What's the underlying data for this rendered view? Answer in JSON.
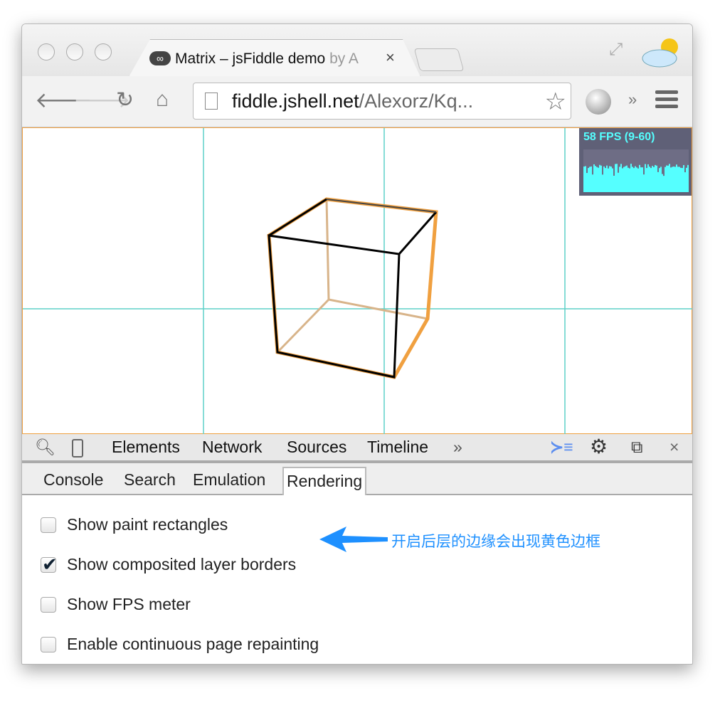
{
  "tab": {
    "title": "Matrix – jsFiddle demo ",
    "title_fade": "by A",
    "close": "×"
  },
  "toolbar": {
    "url_host": "fiddle.jshell.net",
    "url_path": "/Alexorz/Kq..."
  },
  "fps": {
    "label": "58 FPS (9-60)",
    "color": "#55ffff"
  },
  "devtools": {
    "tabs": [
      "Elements",
      "Network",
      "Sources",
      "Timeline",
      "»"
    ],
    "drawer_tabs": [
      "Console",
      "Search",
      "Emulation",
      "Rendering"
    ],
    "active_drawer_tab": "Rendering"
  },
  "rendering": {
    "options": [
      {
        "label": "Show paint rectangles",
        "checked": false
      },
      {
        "label": "Show composited layer borders",
        "checked": true
      },
      {
        "label": "Show FPS meter",
        "checked": false
      },
      {
        "label": "Enable continuous page repainting",
        "checked": false
      }
    ]
  },
  "annotation": {
    "text": "开启后层的边缘会出现黄色边框",
    "color": "#1e90ff"
  },
  "colors": {
    "layer_border": "#f0a040",
    "grid": "#5fd0c8"
  }
}
